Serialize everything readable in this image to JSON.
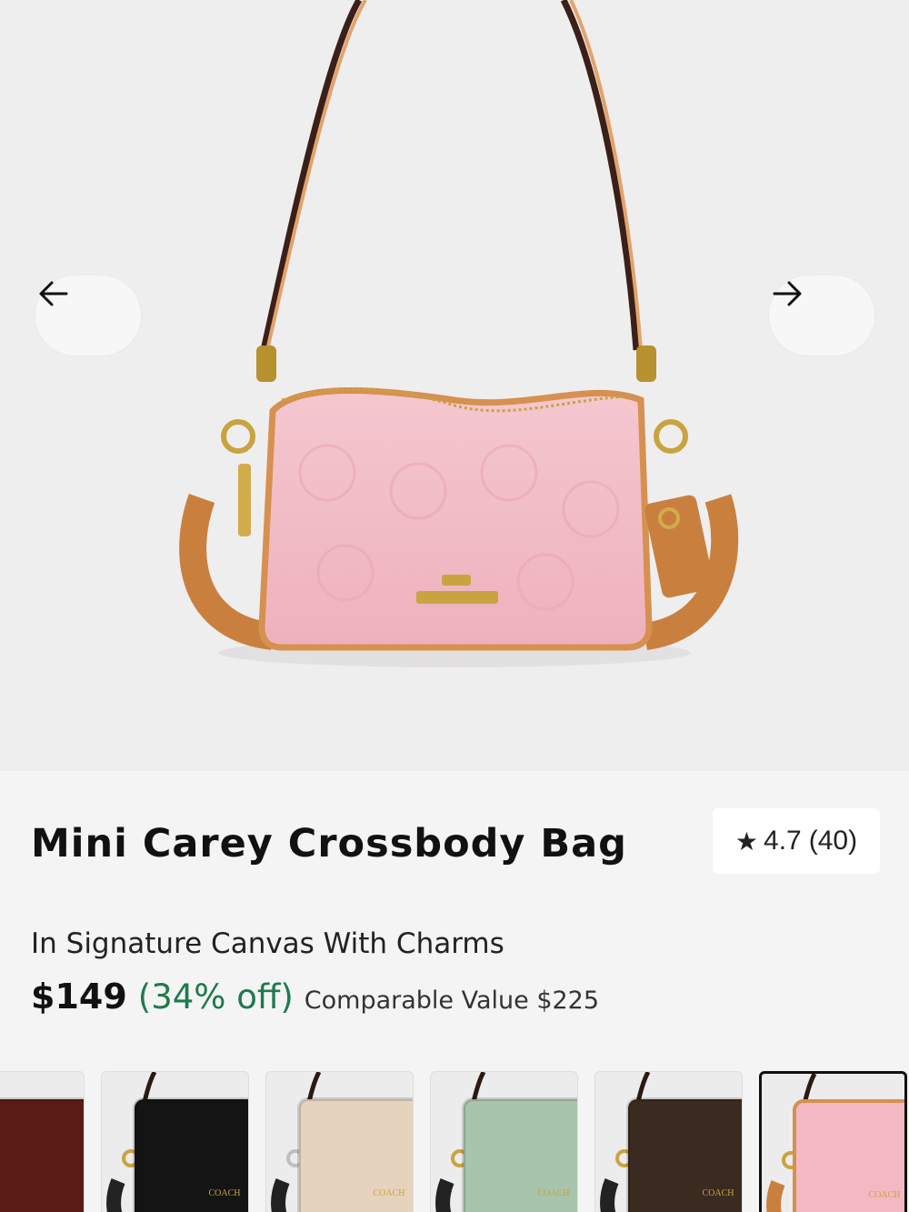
{
  "product": {
    "title": "Mini Carey Crossbody Bag",
    "subtitle": "In Signature Canvas With Charms",
    "price": "$149",
    "discount": "(34% off)",
    "comparable": "Comparable Value $225",
    "rating_value": "4.7",
    "rating_count": "(40)"
  },
  "gallery": {
    "prev_icon": "arrow-left-icon",
    "next_icon": "arrow-right-icon"
  },
  "colors": {
    "bag_pink": "#f2b9c3",
    "trim_tan": "#d6904f",
    "discount_green": "#1e7a4c"
  },
  "swatches": [
    {
      "name": "oxblood",
      "color": "#5a1a16",
      "logo": ""
    },
    {
      "name": "black",
      "color": "#141414",
      "logo": "COACH"
    },
    {
      "name": "ivory",
      "color": "#e6d3bd",
      "logo": "COACH"
    },
    {
      "name": "sage",
      "color": "#a8c4aa",
      "logo": "COACH"
    },
    {
      "name": "brown-signature",
      "color": "#3b2a20",
      "logo": "COACH"
    },
    {
      "name": "pink-signature",
      "color": "#f2b9c3",
      "logo": "COACH",
      "selected": true
    }
  ]
}
